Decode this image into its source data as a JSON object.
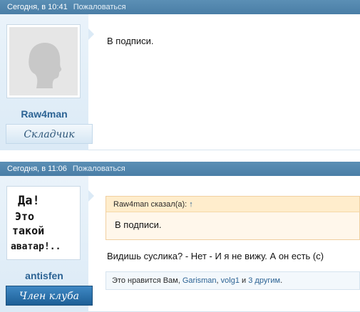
{
  "posts": [
    {
      "time": "Сегодня, в 10:41",
      "report": "Пожаловаться",
      "username": "Raw4man",
      "user_title": "Складчик",
      "content": "В подписи."
    },
    {
      "time": "Сегодня, в 11:06",
      "report": "Пожаловаться",
      "username": "antisfen",
      "user_title": "Член клуба",
      "avatar_text": [
        "Да!",
        "Это",
        "такой",
        "аватар!.."
      ],
      "quote": {
        "author": "Raw4man сказал(а):",
        "arrow": "↑",
        "text": "В подписи."
      },
      "message": "Видишь суслика? - Нет - И я не вижу. А он есть (с)",
      "likes": {
        "prefix": "Это нравится Вам,",
        "user1": "Garisman",
        "comma": ",",
        "user2": "volg1",
        "and": "и",
        "others": "3 другим",
        "suffix": "."
      }
    }
  ],
  "colors": {
    "header": "#4a7ea6",
    "sidebar": "#dbeaf6",
    "username": "#2c6394",
    "quote_bg": "#fff7eb"
  }
}
